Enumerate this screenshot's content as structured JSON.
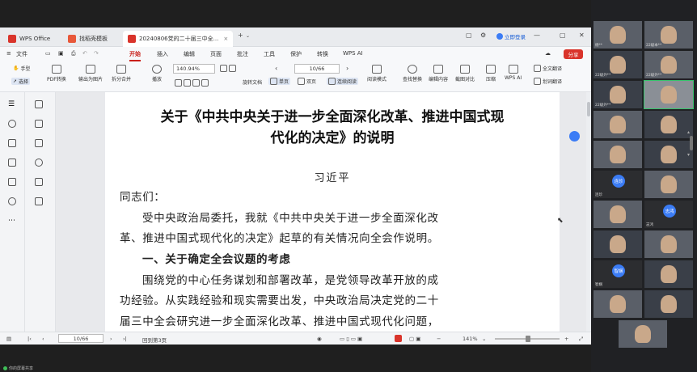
{
  "tabs": [
    {
      "label": "WPS Office"
    },
    {
      "label": "找稻壳模板"
    },
    {
      "label": "20240806党的二十届三中全..."
    }
  ],
  "login_label": "立即登录",
  "menu": {
    "file": "文件",
    "items": [
      "开始",
      "插入",
      "编辑",
      "页面",
      "批注",
      "工具",
      "保护",
      "转换",
      "WPS AI"
    ],
    "active": "开始",
    "share": "分享"
  },
  "ribbon": {
    "hand": "手型",
    "select": "选择",
    "pdf_convert": "PDF转换",
    "export_image": "输出为图片",
    "split_merge": "拆分合并",
    "play": "播放",
    "zoom": "140.94%",
    "rotate_doc": "旋转文档",
    "page_input": "10/66",
    "single_page": "单页",
    "double_page": "双页",
    "continuous": "连续阅读",
    "read_mode": "阅读模式",
    "find_replace": "查找替换",
    "edit_content": "编辑内容",
    "screenshot_compare": "截图对比",
    "compress": "压缩",
    "wps_ai": "WPS AI",
    "full_translate": "全文翻译",
    "word_translate": "划词翻译"
  },
  "document": {
    "title_line1": "关于《中共中央关于进一步全面深化改革、推进中国式现",
    "title_line2": "代化的决定》的说明",
    "author": "习近平",
    "salutation": "同志们：",
    "p1_line1": "受中央政治局委托，我就《中共中央关于进一步全面深化改",
    "p1_line2": "革、推进中国式现代化的决定》起草的有关情况向全会作说明。",
    "heading1": "一、关于确定全会议题的考虑",
    "p2_line1": "围绕党的中心任务谋划和部署改革，是党领导改革开放的成",
    "p2_line2": "功经验。从实践经验和现实需要出发，中央政治局决定党的二十",
    "p2_line3": "届三中全会研究进一步全面深化改革、推进中国式现代化问题，"
  },
  "status": {
    "page": "10/66",
    "back": "回到第3页",
    "zoom": "141%"
  },
  "screenshare_label": "你的屏幕共享",
  "participants": [
    {
      "name": "杨**",
      "type": "cam"
    },
    {
      "name": "22级本**",
      "type": "cam"
    },
    {
      "name": "22级外**",
      "type": "cam2"
    },
    {
      "name": "22级外**",
      "type": "cam"
    },
    {
      "name": "22级外**",
      "type": "cam2"
    },
    {
      "name": "",
      "type": "light"
    },
    {
      "name": "",
      "type": "cam"
    },
    {
      "name": "",
      "type": "cam2"
    },
    {
      "name": "",
      "type": "cam"
    },
    {
      "name": "",
      "type": "cam2"
    },
    {
      "name": "连珍",
      "type": "avatar",
      "avatar_text": "连珍",
      "color": "#3b7cf5"
    },
    {
      "name": "",
      "type": "cam"
    },
    {
      "name": "",
      "type": "cam"
    },
    {
      "name": "志鸿",
      "type": "avatar",
      "avatar_text": "志鸿",
      "color": "#3b7cf5"
    },
    {
      "name": "",
      "type": "cam2"
    },
    {
      "name": "",
      "type": "cam"
    },
    {
      "name": "智娴",
      "type": "avatar",
      "avatar_text": "智娴",
      "color": "#3b7cf5"
    },
    {
      "name": "",
      "type": "cam2"
    },
    {
      "name": "",
      "type": "cam"
    },
    {
      "name": "",
      "type": "cam2"
    },
    {
      "name": "",
      "type": "cam"
    }
  ]
}
